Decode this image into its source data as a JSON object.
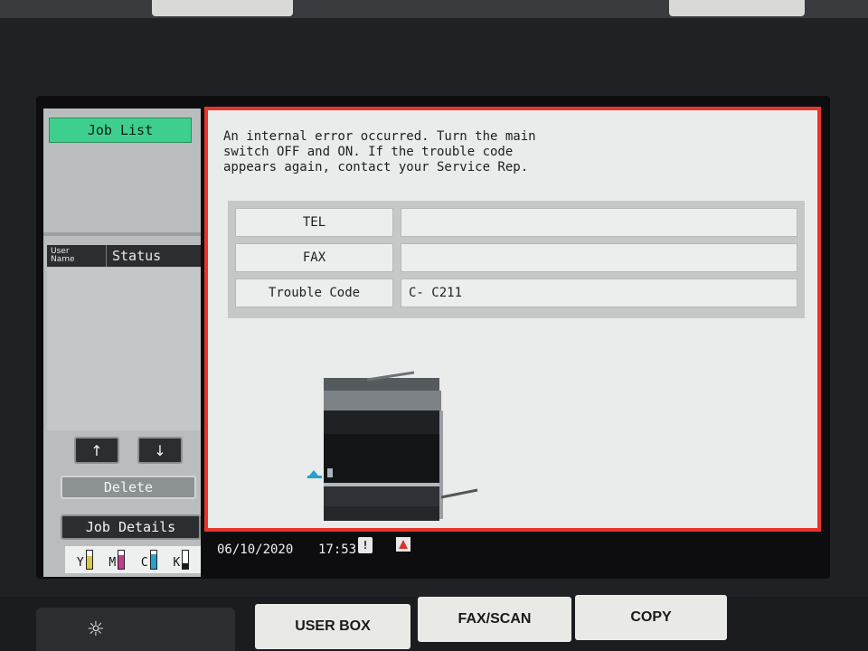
{
  "left_panel": {
    "job_list_label": "Job List",
    "header_user_name_line1": "User",
    "header_user_name_line2": "Name",
    "header_status": "Status",
    "up_arrow": "↑",
    "down_arrow": "↓",
    "delete_label": "Delete",
    "job_details_label": "Job Details",
    "toners": [
      {
        "letter": "Y",
        "color": "#d8c64a",
        "level": 0.7
      },
      {
        "letter": "M",
        "color": "#c23d8e",
        "level": 0.75
      },
      {
        "letter": "C",
        "color": "#2a9fc9",
        "level": 0.8
      },
      {
        "letter": "K",
        "color": "#1a1a1a",
        "level": 0.3
      }
    ]
  },
  "error_dialog": {
    "message": "An internal error occurred. Turn the main\nswitch OFF and ON.  If the trouble code\nappears again, contact your Service Rep.",
    "rows": [
      {
        "label": "TEL",
        "value": ""
      },
      {
        "label": "FAX",
        "value": ""
      },
      {
        "label": "Trouble Code",
        "value": "C- C211"
      }
    ],
    "frame_color": "#e8342c"
  },
  "status_bar": {
    "date": "06/10/2020",
    "time": "17:53",
    "warn_glyph": "!"
  },
  "hard_keys": {
    "brightness_glyph": "☼",
    "user_box": "USER BOX",
    "fax_scan": "FAX/SCAN",
    "copy": "COPY"
  }
}
